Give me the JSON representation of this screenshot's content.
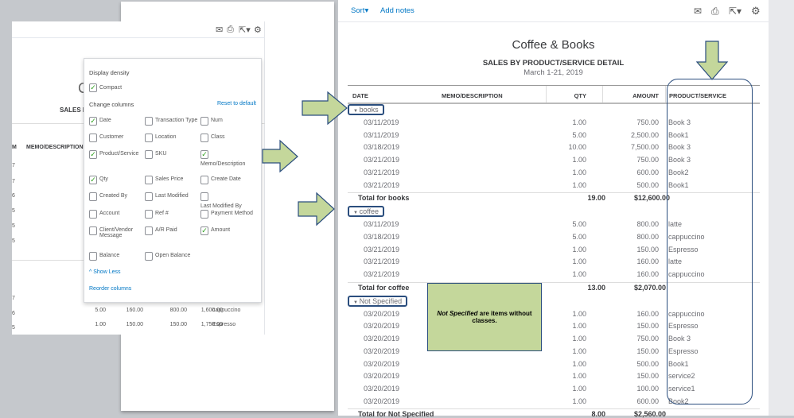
{
  "left_window": {
    "title_partial": "C",
    "subtitle_partial": "SALES BY",
    "col_header_partial": "M",
    "col_memo": "MEMO/DESCRIPTION",
    "stub_values": [
      "7",
      "7",
      "6",
      "5",
      "5",
      "5",
      "7",
      "6",
      "5"
    ],
    "settings": {
      "display_density": "Display density",
      "compact": "Compact",
      "change_columns": "Change columns",
      "reset": "Reset to default",
      "options": [
        {
          "label": "Date",
          "checked": true
        },
        {
          "label": "Transaction Type",
          "checked": false
        },
        {
          "label": "Num",
          "checked": false
        },
        {
          "label": "Customer",
          "checked": false
        },
        {
          "label": "Location",
          "checked": false
        },
        {
          "label": "Class",
          "checked": false
        },
        {
          "label": "Product/Service",
          "checked": true
        },
        {
          "label": "SKU",
          "checked": false
        },
        {
          "label": "Memo/Description",
          "checked": true
        },
        {
          "label": "Qty",
          "checked": true
        },
        {
          "label": "Sales Price",
          "checked": false
        },
        {
          "label": "Create Date",
          "checked": false
        },
        {
          "label": "Created By",
          "checked": false
        },
        {
          "label": "Last Modified",
          "checked": false
        },
        {
          "label": "Last Modified By",
          "checked": false
        },
        {
          "label": "Account",
          "checked": false
        },
        {
          "label": "Ref #",
          "checked": false
        },
        {
          "label": "Payment Method",
          "checked": false
        },
        {
          "label": "Client/Vendor Message",
          "checked": false
        },
        {
          "label": "A/R Paid",
          "checked": false
        },
        {
          "label": "Amount",
          "checked": true
        },
        {
          "label": "Balance",
          "checked": false
        },
        {
          "label": "Open Balance",
          "checked": false
        }
      ],
      "show_less": "Show Less",
      "reorder": "Reorder columns"
    },
    "bottom_rows": [
      [
        "5.00",
        "160.00",
        "800.00",
        "1,600.00",
        "cappuccino"
      ],
      [
        "1.00",
        "150.00",
        "150.00",
        "1,750.00",
        "Espresso"
      ]
    ]
  },
  "report": {
    "toolbar": {
      "sort": "Sort",
      "add_notes": "Add notes"
    },
    "company": "Coffee & Books",
    "title": "SALES BY PRODUCT/SERVICE DETAIL",
    "period": "March 1-21, 2019",
    "columns": [
      "DATE",
      "MEMO/DESCRIPTION",
      "QTY",
      "AMOUNT",
      "PRODUCT/SERVICE"
    ],
    "groups": [
      {
        "name": "books",
        "rows": [
          [
            "03/11/2019",
            "1.00",
            "750.00",
            "Book 3"
          ],
          [
            "03/11/2019",
            "5.00",
            "2,500.00",
            "Book1"
          ],
          [
            "03/18/2019",
            "10.00",
            "7,500.00",
            "Book 3"
          ],
          [
            "03/21/2019",
            "1.00",
            "750.00",
            "Book 3"
          ],
          [
            "03/21/2019",
            "1.00",
            "600.00",
            "Book2"
          ],
          [
            "03/21/2019",
            "1.00",
            "500.00",
            "Book1"
          ]
        ],
        "total_label": "Total for books",
        "total_qty": "19.00",
        "total_amount": "$12,600.00"
      },
      {
        "name": "coffee",
        "rows": [
          [
            "03/11/2019",
            "5.00",
            "800.00",
            "latte"
          ],
          [
            "03/18/2019",
            "5.00",
            "800.00",
            "cappuccino"
          ],
          [
            "03/21/2019",
            "1.00",
            "150.00",
            "Espresso"
          ],
          [
            "03/21/2019",
            "1.00",
            "160.00",
            "latte"
          ],
          [
            "03/21/2019",
            "1.00",
            "160.00",
            "cappuccino"
          ]
        ],
        "total_label": "Total for coffee",
        "total_qty": "13.00",
        "total_amount": "$2,070.00"
      },
      {
        "name": "Not Specified",
        "rows": [
          [
            "03/20/2019",
            "1.00",
            "160.00",
            "cappuccino"
          ],
          [
            "03/20/2019",
            "1.00",
            "150.00",
            "Espresso"
          ],
          [
            "03/20/2019",
            "1.00",
            "750.00",
            "Book 3"
          ],
          [
            "03/20/2019",
            "1.00",
            "150.00",
            "Espresso"
          ],
          [
            "03/20/2019",
            "1.00",
            "500.00",
            "Book1"
          ],
          [
            "03/20/2019",
            "1.00",
            "150.00",
            "service2"
          ],
          [
            "03/20/2019",
            "1.00",
            "100.00",
            "service1"
          ],
          [
            "03/20/2019",
            "1.00",
            "600.00",
            "Book2"
          ]
        ],
        "total_label": "Total for Not Specified",
        "total_qty": "8.00",
        "total_amount": "$2,560.00"
      }
    ]
  },
  "callout": {
    "italic": "Not Specified",
    "rest": " are items without classes."
  },
  "colors": {
    "arrow": "#c4d79b",
    "outline": "#2b4e7e",
    "link": "#0077c5",
    "check": "#2ca01c"
  }
}
